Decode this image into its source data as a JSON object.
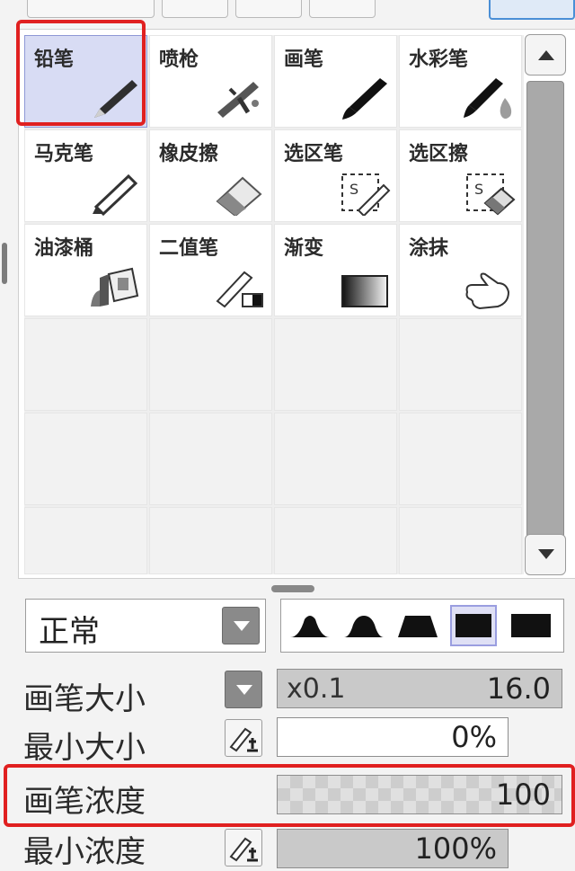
{
  "tools": [
    {
      "label": "铅笔",
      "icon": "pencil-icon",
      "selected": true
    },
    {
      "label": "喷枪",
      "icon": "airbrush-icon"
    },
    {
      "label": "画笔",
      "icon": "brush-icon"
    },
    {
      "label": "水彩笔",
      "icon": "watercolor-brush-icon"
    },
    {
      "label": "马克笔",
      "icon": "marker-icon"
    },
    {
      "label": "橡皮擦",
      "icon": "eraser-icon"
    },
    {
      "label": "选区笔",
      "icon": "selection-pen-icon"
    },
    {
      "label": "选区擦",
      "icon": "selection-eraser-icon"
    },
    {
      "label": "油漆桶",
      "icon": "paint-bucket-icon"
    },
    {
      "label": "二值笔",
      "icon": "binary-pen-icon"
    },
    {
      "label": "渐变",
      "icon": "gradient-icon"
    },
    {
      "label": "涂抹",
      "icon": "smudge-hand-icon"
    }
  ],
  "blend_mode": {
    "value": "正常"
  },
  "brush_shapes": {
    "selected_index": 3
  },
  "properties": {
    "brush_size": {
      "label": "画笔大小",
      "multiplier": "x0.1",
      "value": "16.0"
    },
    "min_size": {
      "label": "最小大小",
      "value": "0%"
    },
    "brush_density": {
      "label": "画笔浓度",
      "value": "100"
    },
    "min_density": {
      "label": "最小浓度",
      "value": "100%"
    }
  },
  "colors": {
    "highlight": "#e02020",
    "selected_cell": "#d8dcf4"
  }
}
